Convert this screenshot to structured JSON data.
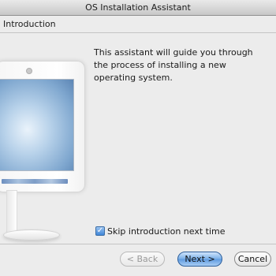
{
  "window": {
    "title": "OS Installation Assistant"
  },
  "section": {
    "title": "Introduction"
  },
  "intro": {
    "text": "This assistant will guide you through the process of installing a new operating system."
  },
  "illustration": {
    "icon": "computer-monitor-illustration"
  },
  "skip": {
    "label": "Skip introduction next time",
    "checked": true
  },
  "buttons": {
    "back": "< Back",
    "next": "Next >",
    "cancel": "Cancel"
  },
  "colors": {
    "primary_button": "#5d9ae0",
    "checkbox": "#3f86d8"
  }
}
